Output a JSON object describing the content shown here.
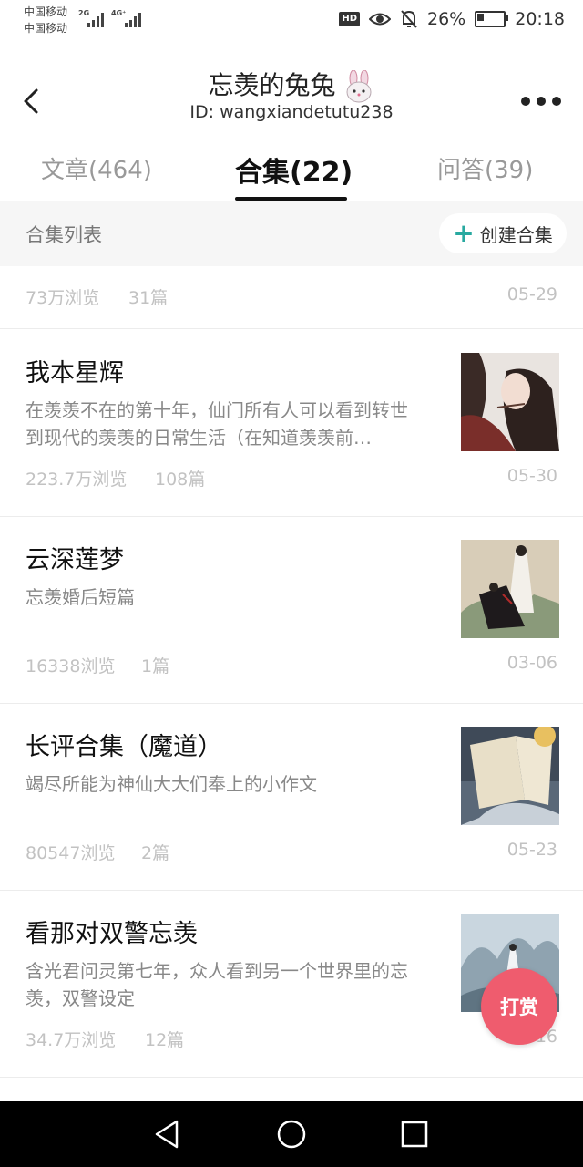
{
  "status_bar": {
    "carrier_1": "中国移动",
    "carrier_2": "中国移动",
    "network_1": "2G",
    "network_2": "4G⁺",
    "battery": "26%",
    "time": "20:18",
    "icons": [
      "hd-icon",
      "eye-icon",
      "mute-bell-icon",
      "battery-charging-icon"
    ]
  },
  "header": {
    "title": "忘羡的兔兔",
    "title_icon": "bunny-icon",
    "user_id": "ID: wangxiandetutu238"
  },
  "tabs": [
    {
      "label": "文章(464)",
      "active": false
    },
    {
      "label": "合集(22)",
      "active": true
    },
    {
      "label": "问答(39)",
      "active": false
    }
  ],
  "list_header": {
    "label": "合集列表",
    "create_button": "创建合集"
  },
  "partial_item": {
    "views": "73万浏览",
    "count": "31篇",
    "date": "05-29"
  },
  "collections": [
    {
      "title": "我本星辉",
      "description": "在羡羡不在的第十年，仙门所有人可以看到转世到现代的羡羡的日常生活（在知道羡羡前…",
      "views": "223.7万浏览",
      "count": "108篇",
      "date": "05-30"
    },
    {
      "title": "云深莲梦",
      "description": "忘羡婚后短篇",
      "views": "16338浏览",
      "count": "1篇",
      "date": "03-06"
    },
    {
      "title": "长评合集（魔道）",
      "description": "竭尽所能为神仙大大们奉上的小作文",
      "views": "80547浏览",
      "count": "2篇",
      "date": "05-23"
    },
    {
      "title": "看那对双警忘羡",
      "description": "含光君问灵第七年，众人看到另一个世界里的忘羡，双警设定",
      "views": "34.7万浏览",
      "count": "12篇",
      "date": "05-16"
    }
  ],
  "reward_button": "打赏",
  "colors": {
    "accent_teal": "#28a9a0",
    "reward_pink": "#ef5c6e"
  }
}
